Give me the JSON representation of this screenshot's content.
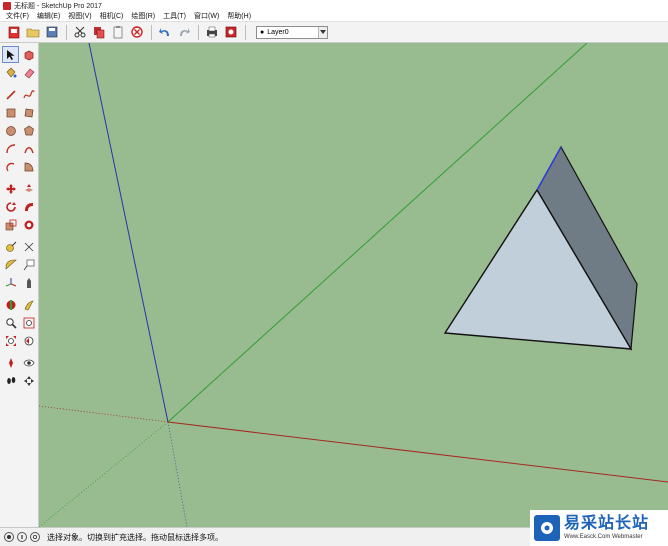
{
  "window": {
    "title": "无标题 - SketchUp Pro 2017"
  },
  "menubar": {
    "items": [
      "文件(F)",
      "编辑(E)",
      "视图(V)",
      "相机(C)",
      "绘图(R)",
      "工具(T)",
      "窗口(W)",
      "帮助(H)"
    ]
  },
  "toolbar": {
    "layer": {
      "selected": "Layer0",
      "dot": "●"
    }
  },
  "status": {
    "text": "选择对象。切换到扩充选择。拖动鼠标选择多项。"
  },
  "watermark": {
    "main": "易采站长站",
    "sub": "Www.Easck.Com Webmaster"
  },
  "colors": {
    "viewport_bg": "#99bb90",
    "face_front": "#c0cfd9",
    "face_side": "#6f7b85",
    "axis_red": "#a32a1e",
    "axis_green": "#2fa02f",
    "axis_blue": "#3030a8",
    "selected_edge": "#2a3ae0"
  }
}
